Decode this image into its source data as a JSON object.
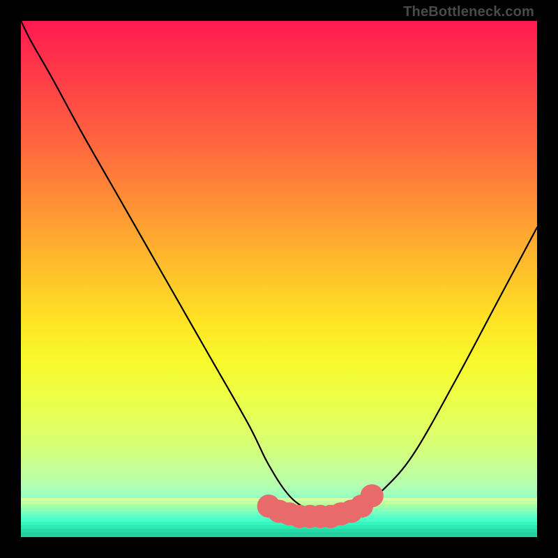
{
  "watermark": "TheBottleneck.com",
  "colors": {
    "gradient_top": "#ff1a50",
    "gradient_bottom": "#2effc4",
    "blob": "#e86a6a",
    "curve": "#000000",
    "frame": "#000000"
  },
  "chart_data": {
    "type": "line",
    "title": "",
    "xlabel": "",
    "ylabel": "",
    "xlim": [
      0,
      100
    ],
    "ylim": [
      0,
      100
    ],
    "grid": false,
    "legend": false,
    "notes": "Axes are unlabeled; values are estimated from pixel positions normalized to a 0–100 virtual coordinate system. y=0 is the bottom of the colored plot area.",
    "series": [
      {
        "name": "bottleneck-curve",
        "x": [
          0,
          2,
          6,
          12,
          20,
          28,
          36,
          44,
          48,
          52,
          56,
          58,
          60,
          64,
          66,
          70,
          76,
          84,
          92,
          100
        ],
        "y": [
          100,
          96,
          89,
          78,
          64,
          50,
          36,
          22,
          14,
          8,
          5,
          4,
          4,
          5,
          6,
          9,
          16,
          30,
          45,
          60
        ]
      }
    ],
    "markers": [
      {
        "name": "floor-blob",
        "x": 48,
        "y": 6,
        "r": 1.6
      },
      {
        "name": "floor-blob",
        "x": 50,
        "y": 5,
        "r": 1.6
      },
      {
        "name": "floor-blob",
        "x": 52,
        "y": 4.5,
        "r": 1.6
      },
      {
        "name": "floor-blob",
        "x": 54,
        "y": 4,
        "r": 1.6
      },
      {
        "name": "floor-blob",
        "x": 56,
        "y": 4,
        "r": 1.6
      },
      {
        "name": "floor-blob",
        "x": 58,
        "y": 4,
        "r": 1.6
      },
      {
        "name": "floor-blob",
        "x": 60,
        "y": 4,
        "r": 1.6
      },
      {
        "name": "floor-blob",
        "x": 62,
        "y": 4.5,
        "r": 1.6
      },
      {
        "name": "floor-blob",
        "x": 64,
        "y": 5,
        "r": 1.6
      },
      {
        "name": "floor-blob",
        "x": 66,
        "y": 6,
        "r": 1.6
      },
      {
        "name": "floor-blob",
        "x": 68,
        "y": 8,
        "r": 1.6
      }
    ],
    "background_gradient": "vertical rainbow: red (top) -> yellow -> green (bottom)"
  }
}
